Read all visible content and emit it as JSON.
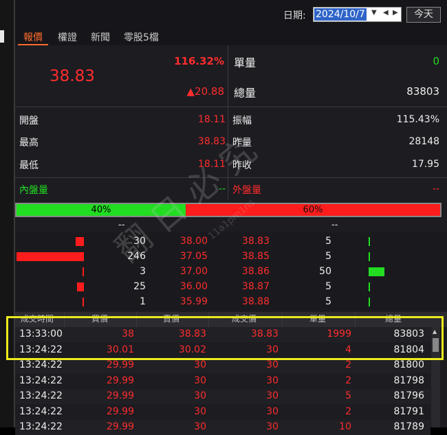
{
  "toolbar": {
    "date_label": "日期:",
    "date_value": "2024/10/7",
    "today_label": "今天"
  },
  "tabs": [
    {
      "label": "報價"
    },
    {
      "label": "權證"
    },
    {
      "label": "新聞"
    },
    {
      "label": "零股5檔"
    }
  ],
  "quote": {
    "price": "38.83",
    "change_pct": "116.32%",
    "change": "▲20.88",
    "single_volume_label": "單量",
    "single_volume": "0",
    "total_volume_label": "總量",
    "total_volume": "83803",
    "open_label": "開盤",
    "open": "18.11",
    "amplitude_label": "振幅",
    "amplitude": "115.43%",
    "high_label": "最高",
    "high": "38.83",
    "prev_volume_label": "昨量",
    "prev_volume": "28148",
    "low_label": "最低",
    "low": "18.11",
    "prev_close_label": "昨收",
    "prev_close": "17.95",
    "inner_label": "內盤量",
    "inner_value": "--",
    "outer_label": "外盤量",
    "outer_value": "--",
    "buy_ratio": "40%",
    "sell_ratio": "60%",
    "buy_total": "--",
    "sell_total": "--",
    "colors": {
      "up": "#ff2d2d",
      "down": "#22dd22",
      "highlight": "#ecec1e"
    }
  },
  "order_book": [
    {
      "bid_qty": "30",
      "bid": "38.00",
      "ask": "38.83",
      "ask_qty": "5"
    },
    {
      "bid_qty": "246",
      "bid": "37.05",
      "ask": "38.85",
      "ask_qty": "5"
    },
    {
      "bid_qty": "3",
      "bid": "37.00",
      "ask": "38.86",
      "ask_qty": "50"
    },
    {
      "bid_qty": "25",
      "bid": "36.00",
      "ask": "38.87",
      "ask_qty": "5"
    },
    {
      "bid_qty": "1",
      "bid": "35.99",
      "ask": "38.88",
      "ask_qty": "5"
    }
  ],
  "trades": {
    "headers": [
      "成交時間",
      "買價",
      "賣價",
      "成交價",
      "單量",
      "總量"
    ],
    "rows": [
      {
        "time": "13:33:00",
        "bid": "38",
        "ask": "38.83",
        "price": "38.83",
        "qty": "1999",
        "total": "83803"
      },
      {
        "time": "13:24:22",
        "bid": "30.01",
        "ask": "30.02",
        "price": "30",
        "qty": "4",
        "total": "81804"
      },
      {
        "time": "13:24:22",
        "bid": "29.99",
        "ask": "30",
        "price": "30",
        "qty": "2",
        "total": "81800"
      },
      {
        "time": "13:24:22",
        "bid": "29.99",
        "ask": "30",
        "price": "30",
        "qty": "2",
        "total": "81798"
      },
      {
        "time": "13:24:22",
        "bid": "29.99",
        "ask": "30",
        "price": "30",
        "qty": "5",
        "total": "81796"
      },
      {
        "time": "13:24:22",
        "bid": "29.99",
        "ask": "30",
        "price": "30",
        "qty": "2",
        "total": "81791"
      },
      {
        "time": "13:24:22",
        "bid": "29.99",
        "ask": "30",
        "price": "30",
        "qty": "10",
        "total": "81789"
      }
    ]
  },
  "watermark": {
    "main": "翻 日 必 究",
    "sub": "11a1pm1ns"
  }
}
